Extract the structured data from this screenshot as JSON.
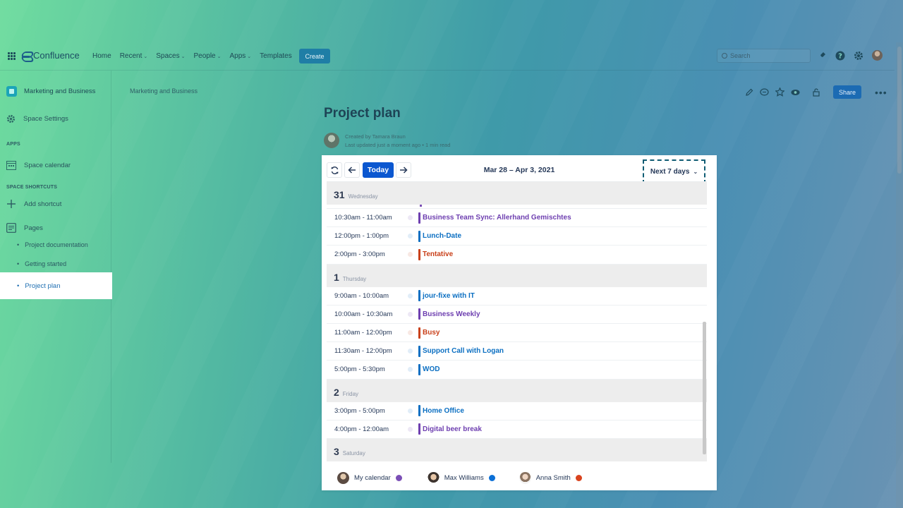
{
  "app": {
    "name": "Confluence"
  },
  "nav": {
    "items": [
      {
        "label": "Home",
        "dropdown": false
      },
      {
        "label": "Recent",
        "dropdown": true
      },
      {
        "label": "Spaces",
        "dropdown": true
      },
      {
        "label": "People",
        "dropdown": true
      },
      {
        "label": "Apps",
        "dropdown": true
      },
      {
        "label": "Templates",
        "dropdown": false
      }
    ],
    "create_label": "Create",
    "search_placeholder": "Search"
  },
  "sidebar": {
    "space_name": "Marketing and Business",
    "space_settings": "Space Settings",
    "apps_heading": "APPS",
    "space_calendar": "Space calendar",
    "shortcuts_heading": "SPACE SHORTCUTS",
    "add_shortcut": "Add shortcut",
    "pages": "Pages",
    "page_items": [
      "Project documentation",
      "Getting started",
      "Project plan"
    ]
  },
  "page": {
    "breadcrumb": "Marketing and Business",
    "title": "Project plan",
    "created_by": "Created by Tamara Braun",
    "last_updated": "Last updated just a moment ago",
    "read_time": "1 min read",
    "share_label": "Share"
  },
  "calendar": {
    "today_label": "Today",
    "range": "Mar 28 – Apr 3, 2021",
    "view": "Next 7 days",
    "colors": {
      "purple": "#6e3fb0",
      "blue": "#0b6fc2",
      "red": "#c9401a"
    },
    "days": [
      {
        "num": "31",
        "name": "Wednesday",
        "events": [
          {
            "time": "10:30am - 11:00am",
            "title": "Business Team Sync: Allerhand Gemischtes",
            "color": "purple"
          },
          {
            "time": "12:00pm - 1:00pm",
            "title": "Lunch-Date",
            "color": "blue"
          },
          {
            "time": "2:00pm - 3:00pm",
            "title": "Tentative",
            "color": "red"
          }
        ]
      },
      {
        "num": "1",
        "name": "Thursday",
        "events": [
          {
            "time": "9:00am - 10:00am",
            "title": "jour-fixe with IT",
            "color": "blue"
          },
          {
            "time": "10:00am - 10:30am",
            "title": "Business Weekly",
            "color": "purple"
          },
          {
            "time": "11:00am - 12:00pm",
            "title": "Busy",
            "color": "red"
          },
          {
            "time": "11:30am - 12:00pm",
            "title": "Support Call with Logan",
            "color": "blue"
          },
          {
            "time": "5:00pm - 5:30pm",
            "title": "WOD",
            "color": "blue"
          }
        ]
      },
      {
        "num": "2",
        "name": "Friday",
        "events": [
          {
            "time": "3:00pm - 5:00pm",
            "title": "Home Office",
            "color": "blue"
          },
          {
            "time": "4:00pm - 12:00am",
            "title": "Digital beer break",
            "color": "purple"
          }
        ]
      },
      {
        "num": "3",
        "name": "Saturday",
        "events": []
      }
    ],
    "legend": [
      {
        "name": "My calendar",
        "color": "#7b4fb6"
      },
      {
        "name": "Max Williams",
        "color": "#0b6fd6"
      },
      {
        "name": "Anna Smith",
        "color": "#d9431e"
      }
    ]
  }
}
